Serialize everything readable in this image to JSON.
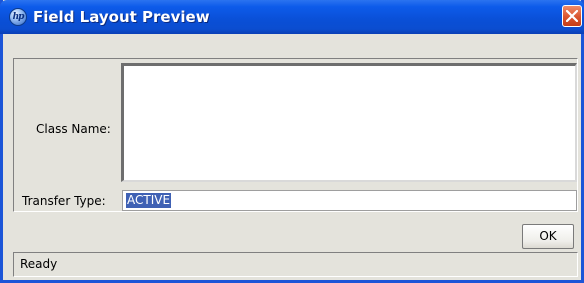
{
  "window": {
    "title": "Field Layout Preview",
    "app_icon_text": "hp",
    "close_icon": "close-icon"
  },
  "form": {
    "class_name_label": "Class Name:",
    "class_name_value": "",
    "transfer_type_label": "Transfer Type:",
    "transfer_type_value": "ACTIVE"
  },
  "buttons": {
    "ok_label": "OK"
  },
  "status": {
    "text": "Ready"
  },
  "colors": {
    "titlebar": "#0a4fd6",
    "window_bg": "#e4e3dc",
    "selection": "#3f61b4",
    "close_button": "#d9542e"
  }
}
